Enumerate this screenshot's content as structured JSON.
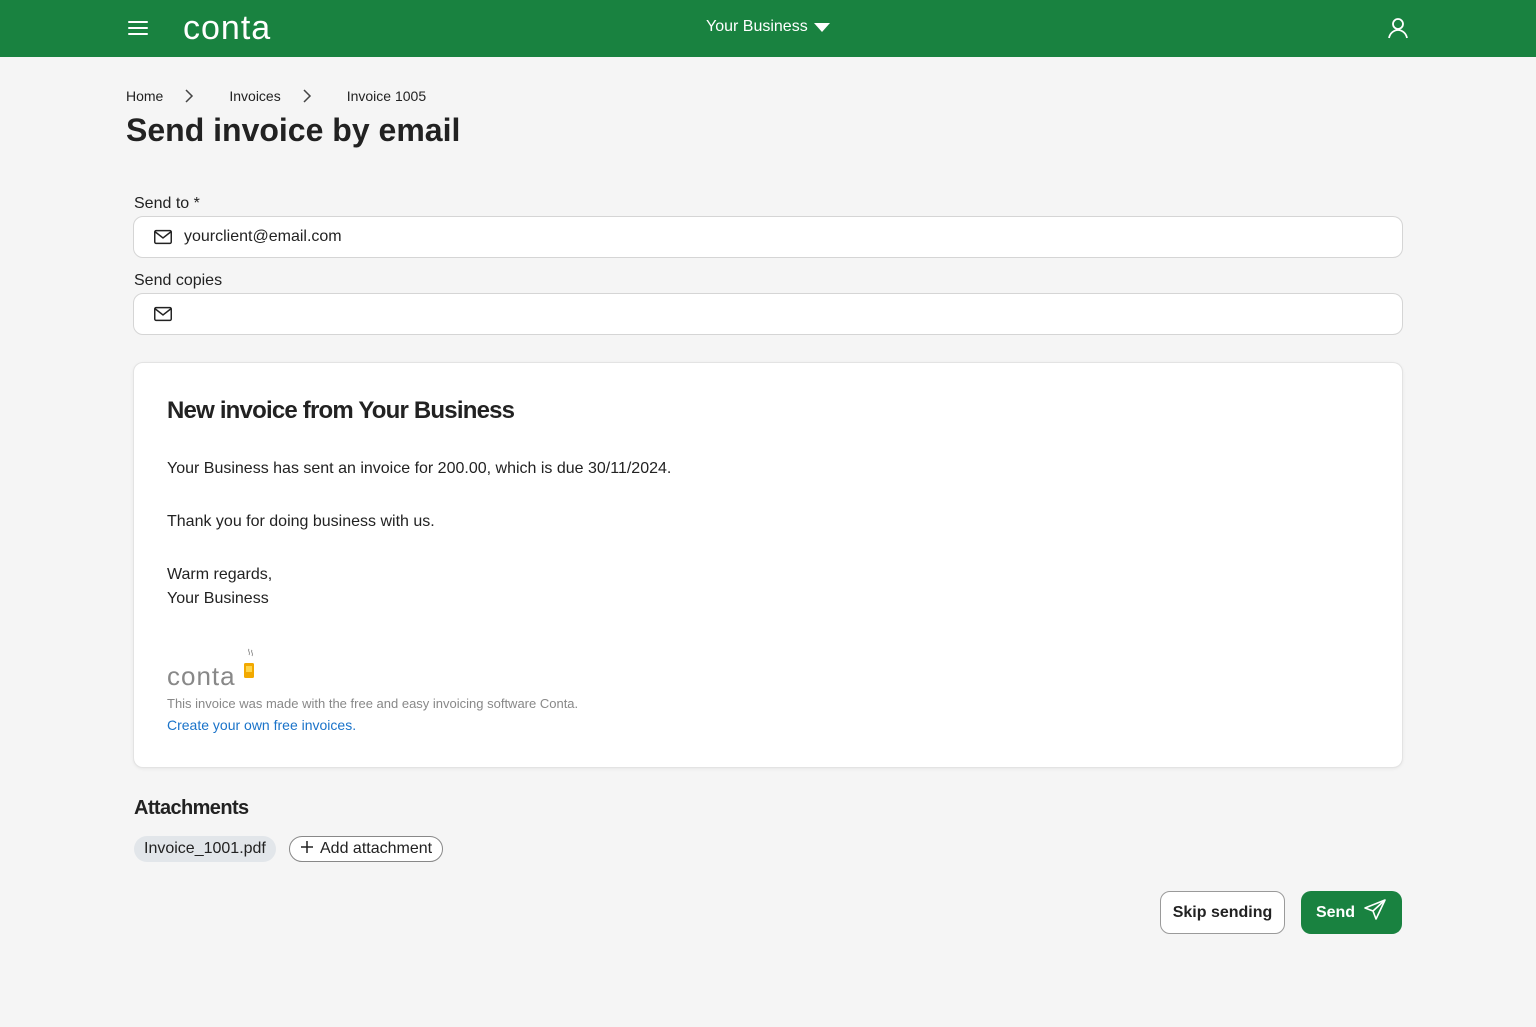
{
  "header": {
    "brand": "conta",
    "business": "Your Business"
  },
  "breadcrumb": {
    "items": [
      "Home",
      "Invoices",
      "Invoice 1005"
    ]
  },
  "page": {
    "title": "Send invoice by email"
  },
  "form": {
    "send_to_label": "Send to *",
    "send_to_value": "yourclient@email.com",
    "copies_label": "Send copies",
    "copies_value": ""
  },
  "preview": {
    "heading": "New invoice from Your Business",
    "line1": "Your Business has sent an invoice for 200.00, which is due 30/11/2024.",
    "line2": "Thank you for doing business with us.",
    "line3": "Warm regards,",
    "line4": "Your Business",
    "footer_brand": "conta",
    "footer_text": "This invoice was made with the free and easy invoicing software Conta.",
    "footer_link": "Create your own free invoices."
  },
  "attachments": {
    "title": "Attachments",
    "files": [
      "Invoice_1001.pdf"
    ],
    "add_label": "Add attachment"
  },
  "actions": {
    "skip_label": "Skip sending",
    "send_label": "Send"
  },
  "colors": {
    "brand_green": "#198240",
    "link_blue": "#1a73c9",
    "page_bg": "#f5f5f5"
  }
}
